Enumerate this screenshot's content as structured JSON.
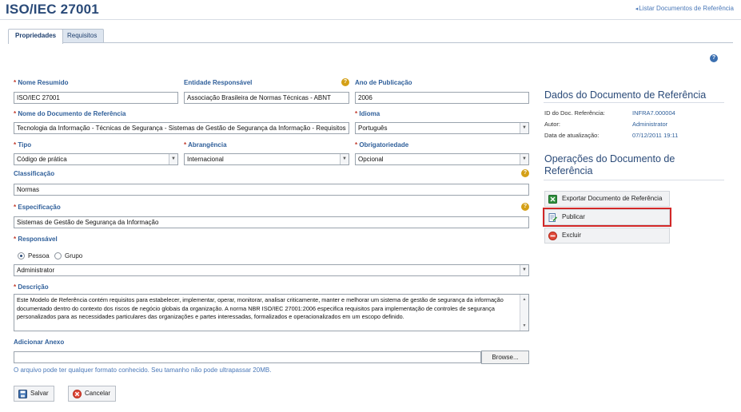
{
  "header": {
    "title": "ISO/IEC 27001",
    "back_link": "Listar Documentos de Referência"
  },
  "tabs": [
    {
      "label": "Propriedades",
      "active": true
    },
    {
      "label": "Requisitos",
      "active": false
    }
  ],
  "form": {
    "nome_resumido": {
      "label": "Nome Resumido",
      "value": "ISO/IEC 27001",
      "required": true
    },
    "entidade": {
      "label": "Entidade Responsável",
      "value": "Associação Brasileira de Normas Técnicas - ABNT"
    },
    "ano": {
      "label": "Ano de Publicação",
      "value": "2006"
    },
    "nome_documento": {
      "label": "Nome do Documento de Referência",
      "value": "Tecnologia da Informação - Técnicas de Segurança - Sistemas de Gestão de Segurança da Informação - Requisitos",
      "required": true
    },
    "idioma": {
      "label": "Idioma",
      "value": "Português",
      "required": true
    },
    "tipo": {
      "label": "Tipo",
      "value": "Código de prática",
      "required": true
    },
    "abrangencia": {
      "label": "Abrangência",
      "value": "Internacional",
      "required": true
    },
    "obrigatoriedade": {
      "label": "Obrigatoriedade",
      "value": "Opcional",
      "required": true
    },
    "classificacao": {
      "label": "Classificação",
      "value": "Normas"
    },
    "especificacao": {
      "label": "Especificação",
      "value": "Sistemas de Gestão de Segurança da Informação",
      "required": true
    },
    "responsavel": {
      "label": "Responsável",
      "required": true,
      "options": [
        "Pessoa",
        "Grupo"
      ],
      "selected": "Pessoa",
      "value": "Administrator"
    },
    "descricao": {
      "label": "Descrição",
      "required": true,
      "value": "Este Modelo de Referência contém requisitos para estabelecer, implementar, operar, monitorar, analisar criticamente, manter e melhorar um sistema de gestão de segurança da informação documentado dentro do contexto dos riscos de negócio globais da organização. A norma NBR ISO/IEC 27001:2006 especifica requisitos para implementação de controles de segurança personalizados para as necessidades particulares das organizações e partes interessadas, formalizados e operacionalizados em um escopo definido."
    },
    "anexo": {
      "label": "Adicionar Anexo",
      "value": "",
      "browse_label": "Browse...",
      "hint": "O arquivo pode ter qualquer formato conhecido. Seu tamanho não pode ultrapassar 20MB."
    },
    "required_mark": "*",
    "save_label": "Salvar",
    "cancel_label": "Cancelar"
  },
  "side": {
    "dados_title": "Dados do Documento de Referência",
    "info": [
      {
        "label": "ID do Doc. Referência:",
        "value": "INFRA7.000004"
      },
      {
        "label": "Autor:",
        "value": "Administrator"
      },
      {
        "label": "Data de atualização:",
        "value": "07/12/2011 19:11"
      }
    ],
    "ops_title": "Operações do Documento de Referência",
    "ops": [
      {
        "label": "Exportar Documento de Referência",
        "icon": "excel-icon"
      },
      {
        "label": "Publicar",
        "icon": "publish-icon",
        "highlighted": true
      },
      {
        "label": "Excluir",
        "icon": "delete-icon"
      }
    ]
  },
  "colors": {
    "title": "#2a4a78",
    "label": "#2f5f9a",
    "required": "#c0392b",
    "highlight": "#d22727"
  }
}
